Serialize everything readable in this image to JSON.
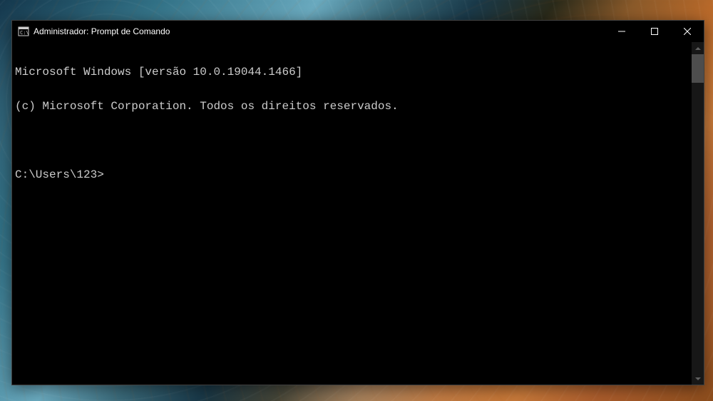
{
  "window": {
    "title": "Administrador: Prompt de Comando"
  },
  "terminal": {
    "lines": [
      "Microsoft Windows [versão 10.0.19044.1466]",
      "(c) Microsoft Corporation. Todos os direitos reservados.",
      "",
      "C:\\Users\\123>"
    ]
  }
}
